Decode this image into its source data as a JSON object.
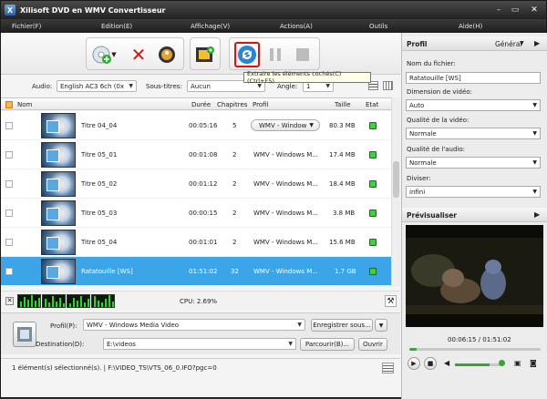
{
  "window": {
    "title": "Xilisoft DVD en WMV Convertisseur",
    "minimize": "–",
    "restore": "▭",
    "close": "✕"
  },
  "menu": [
    "Fichier(F)",
    "Edition(E)",
    "Affichage(V)",
    "Actions(A)",
    "Outils",
    "Aide(H)"
  ],
  "toolbar": {
    "tooltip": "Extraire les éléments cochés(C) (Ctrl+F5)"
  },
  "filters": {
    "audio_label": "Audio:",
    "audio_value": "English AC3 6ch (0x",
    "subtitles_label": "Sous-titres:",
    "subtitles_value": "Aucun",
    "angle_label": "Angle:",
    "angle_value": "1"
  },
  "list": {
    "columns": {
      "name": "Nom",
      "duration": "Durée",
      "chapters": "Chapitres",
      "profile": "Profil",
      "size": "Taille",
      "state": "Etat"
    },
    "rows": [
      {
        "name": "Titre 04_04",
        "duration": "00:05:16",
        "chapters": "5",
        "profile": "WMV - Window",
        "size": "80.3 MB"
      },
      {
        "name": "Titre 05_01",
        "duration": "00:01:08",
        "chapters": "2",
        "profile": "WMV - Windows M...",
        "size": "17.4 MB"
      },
      {
        "name": "Titre 05_02",
        "duration": "00:01:12",
        "chapters": "2",
        "profile": "WMV - Windows M...",
        "size": "18.4 MB"
      },
      {
        "name": "Titre 05_03",
        "duration": "00:00:15",
        "chapters": "2",
        "profile": "WMV - Windows M...",
        "size": "3.8 MB"
      },
      {
        "name": "Titre 05_04",
        "duration": "00:01:01",
        "chapters": "2",
        "profile": "WMV - Windows M...",
        "size": "15.6 MB"
      },
      {
        "name": "Ratatouille [WS]",
        "duration": "01:51:02",
        "chapters": "32",
        "profile": "WMV - Windows M...",
        "size": "1.7 GB"
      }
    ]
  },
  "cpu": {
    "label": "CPU: 2.69%"
  },
  "output": {
    "profile_label": "Profil(P):",
    "profile_value": "WMV - Windows Media Video",
    "save_as": "Enregistrer sous...",
    "dest_label": "Destination(D):",
    "dest_value": "E:\\videos",
    "browse": "Parcourir(B)...",
    "open": "Ouvrir"
  },
  "status": {
    "text": "1 élément(s) sélectionné(s). | F:\\VIDEO_TS\\VTS_06_0.IFO?pgc=0"
  },
  "profile_panel": {
    "header": "Profil",
    "mode": "Général",
    "filename_label": "Nom du fichier:",
    "filename_value": "Ratatouille [WS]",
    "dimension_label": "Dimension de vidéo:",
    "dimension_value": "Auto",
    "vquality_label": "Qualité de la vidéo:",
    "vquality_value": "Normale",
    "aquality_label": "Qualité de l'audio:",
    "aquality_value": "Normale",
    "split_label": "Diviser:",
    "split_value": "infini"
  },
  "preview": {
    "header": "Prévisualiser",
    "time": "00:06:15 / 01:51:02",
    "progress": 0.056
  },
  "colors": {
    "accent": "#3ba5e8",
    "status_ok": "#3dd13d",
    "title_bg": "#222222"
  }
}
